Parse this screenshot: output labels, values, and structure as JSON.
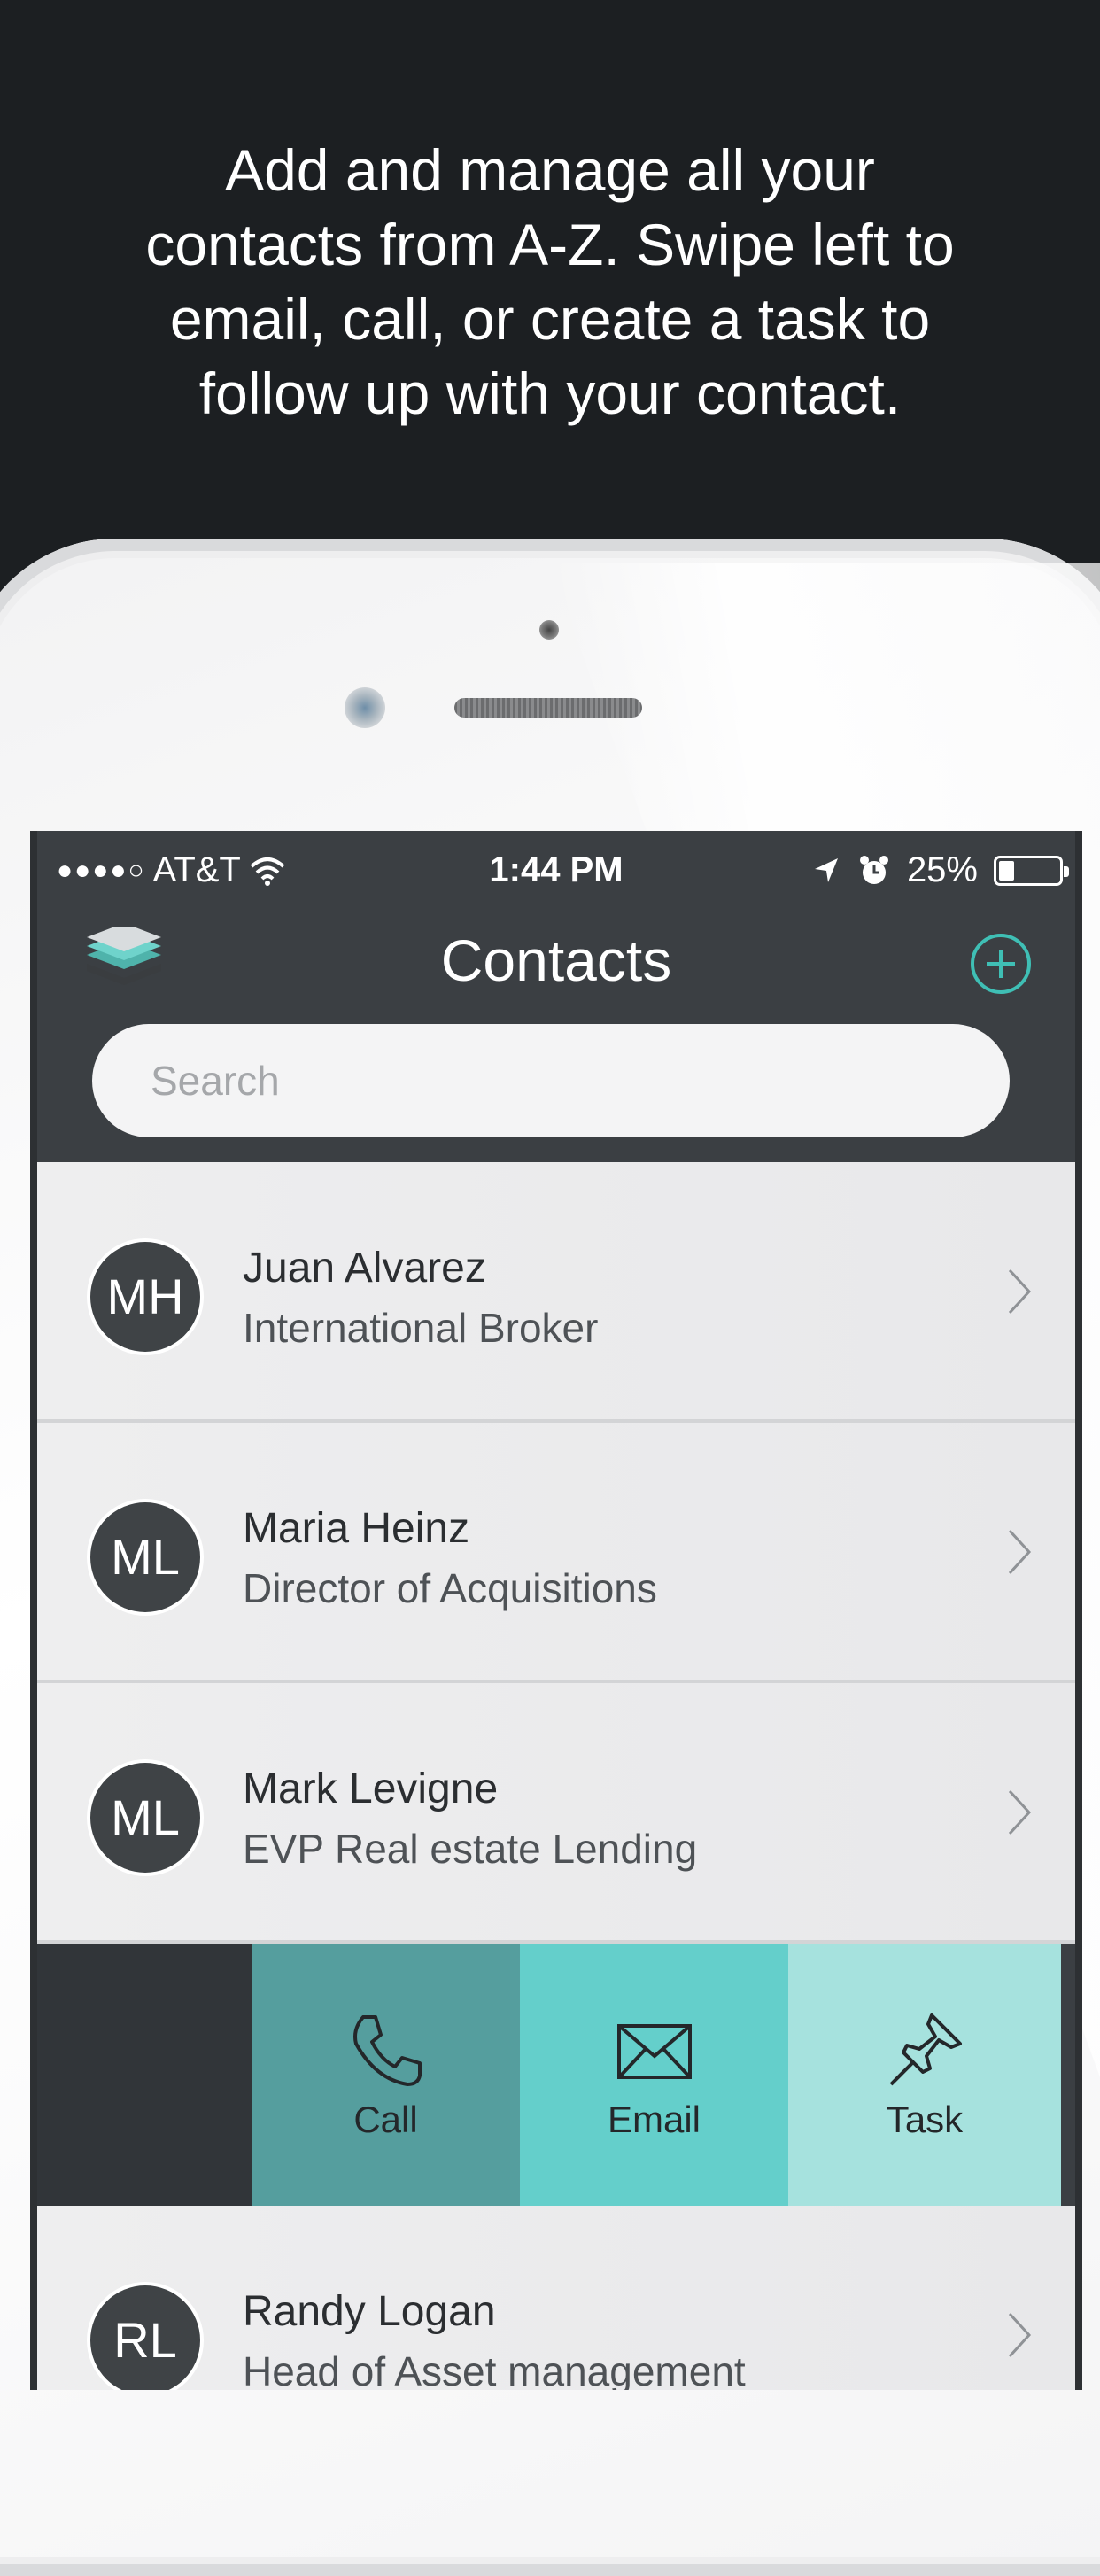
{
  "headline": "Add and manage all your\ncontacts from A-Z. Swipe left to\nemail, call, or create a task to\nfollow up with your contact.",
  "status_bar": {
    "carrier": "AT&T",
    "time": "1:44 PM",
    "battery": "25%",
    "battery_level": 0.25
  },
  "nav": {
    "title": "Contacts",
    "menu_icon": "layers-icon",
    "add_icon": "plus-circle-icon"
  },
  "search": {
    "placeholder": "Search"
  },
  "contacts": [
    {
      "initials": "MH",
      "name": "Juan Alvarez",
      "role": "International Broker"
    },
    {
      "initials": "ML",
      "name": "Maria Heinz",
      "role": "Director of Acquisitions"
    },
    {
      "initials": "ML",
      "name": "Mark Levigne",
      "role": "EVP Real estate Lending"
    },
    {
      "initials": "RL",
      "name": "Randy Logan",
      "role": "Head of Asset management"
    }
  ],
  "swipe_actions": {
    "call": "Call",
    "email": "Email",
    "task": "Task"
  },
  "colors": {
    "background": "#1c1f22",
    "accent": "#3fbfb5",
    "call": "#559e9e",
    "email": "#64cfcb",
    "task": "#a6e2de"
  }
}
